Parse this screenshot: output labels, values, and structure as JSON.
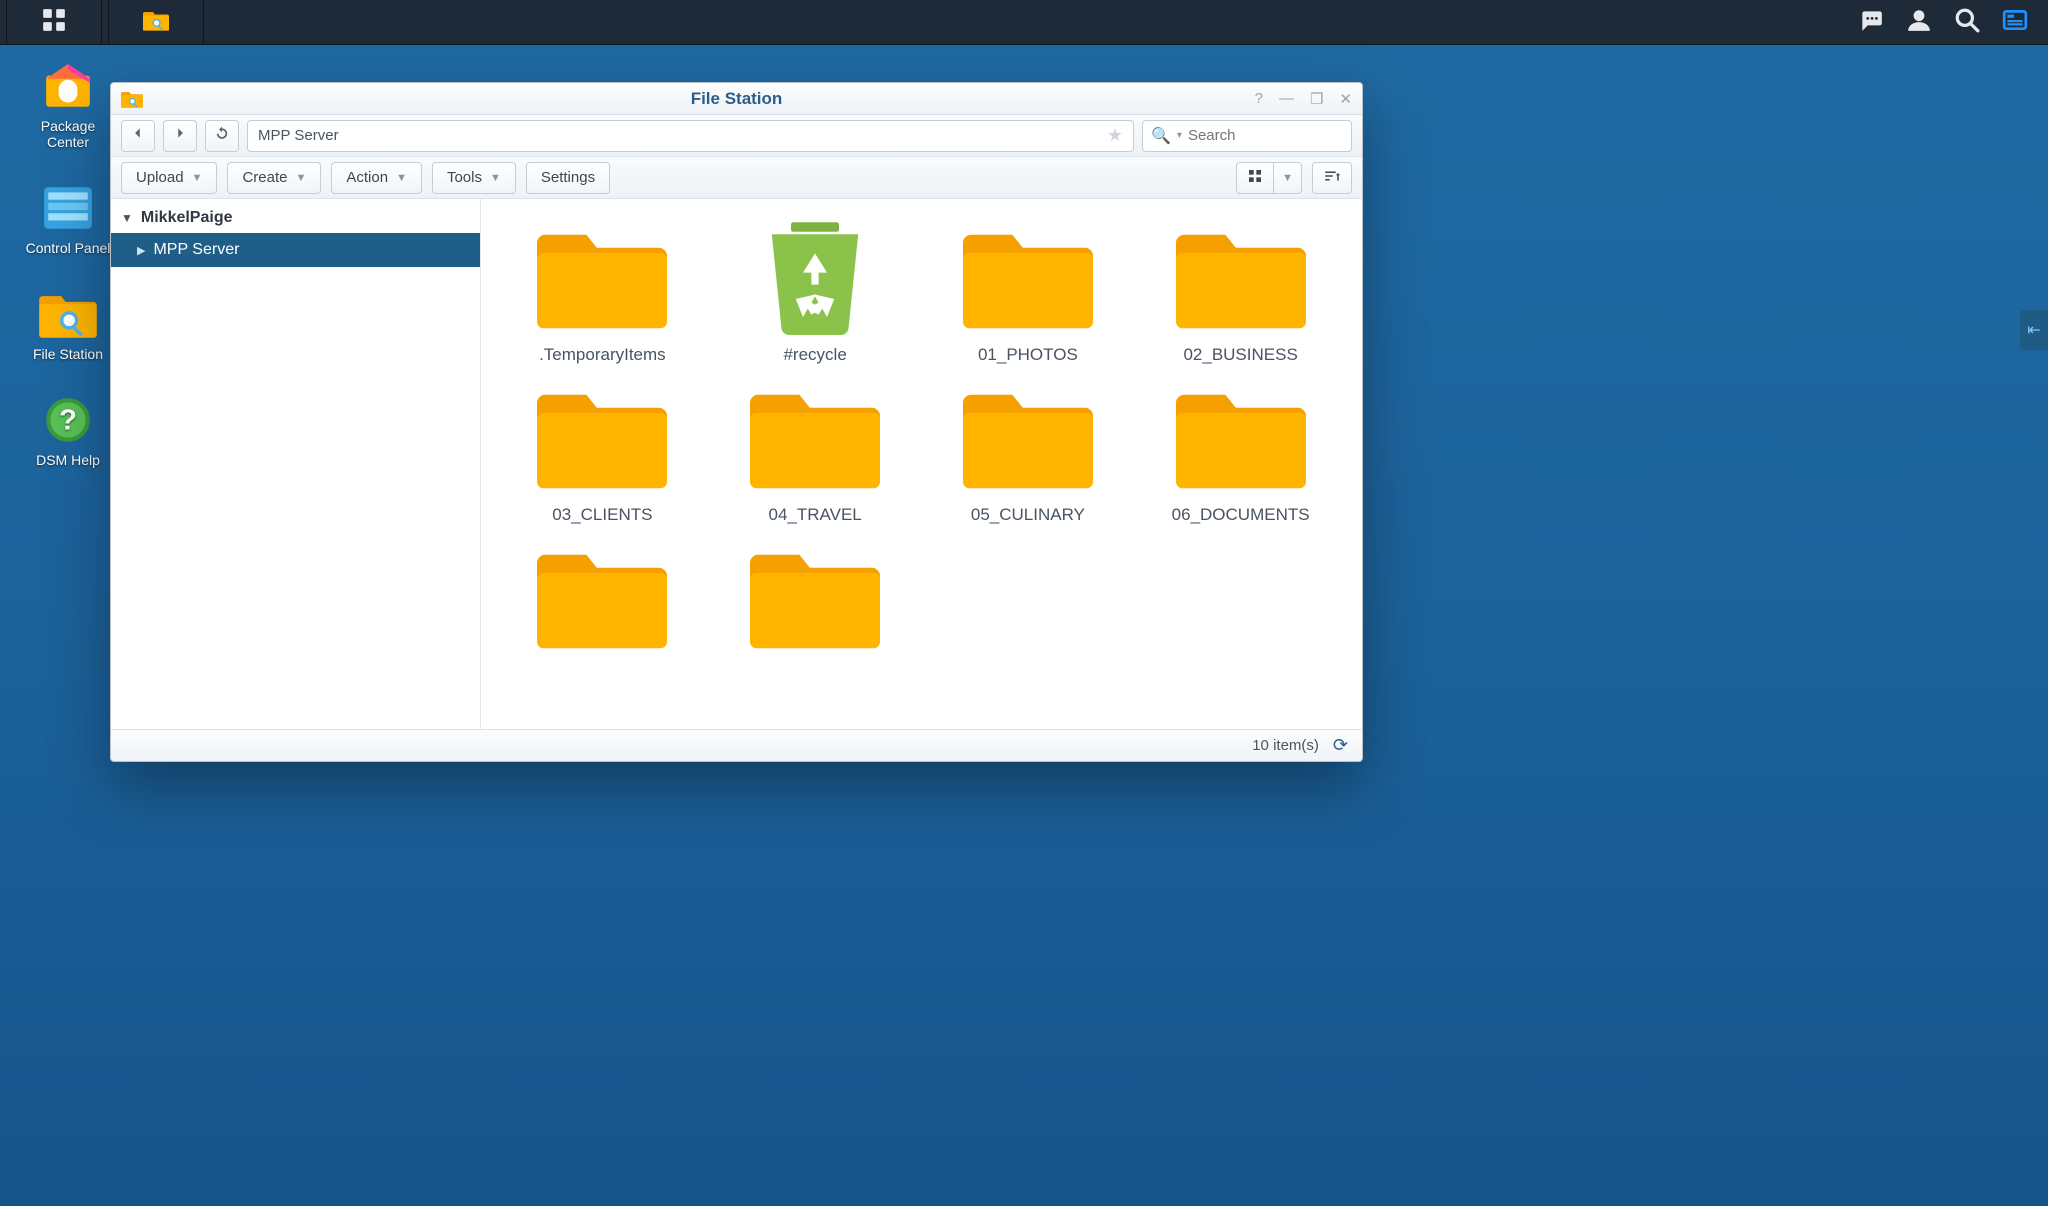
{
  "taskbar": {
    "main_menu": "main-menu",
    "file_station_icon": "file-station",
    "right": [
      "notifications",
      "user",
      "search",
      "widgets"
    ]
  },
  "desktop_icons": [
    {
      "name": "package-center",
      "label": "Package Center"
    },
    {
      "name": "control-panel",
      "label": "Control Panel"
    },
    {
      "name": "file-station",
      "label": "File Station"
    },
    {
      "name": "dsm-help",
      "label": "DSM Help"
    }
  ],
  "window": {
    "title": "File Station",
    "path": "MPP Server",
    "search_placeholder": "Search",
    "toolbar": {
      "upload": "Upload",
      "create": "Create",
      "action": "Action",
      "tools": "Tools",
      "settings": "Settings"
    },
    "tree": {
      "root": "MikkelPaige",
      "selected": "MPP Server"
    },
    "items": [
      {
        "type": "folder",
        "label": ".TemporaryItems"
      },
      {
        "type": "recycle",
        "label": "#recycle"
      },
      {
        "type": "folder",
        "label": "01_PHOTOS"
      },
      {
        "type": "folder",
        "label": "02_BUSINESS"
      },
      {
        "type": "folder",
        "label": "03_CLIENTS"
      },
      {
        "type": "folder",
        "label": "04_TRAVEL"
      },
      {
        "type": "folder",
        "label": "05_CULINARY"
      },
      {
        "type": "folder",
        "label": "06_DOCUMENTS"
      },
      {
        "type": "folder",
        "label": ""
      },
      {
        "type": "folder",
        "label": ""
      }
    ],
    "status": "10 item(s)"
  }
}
